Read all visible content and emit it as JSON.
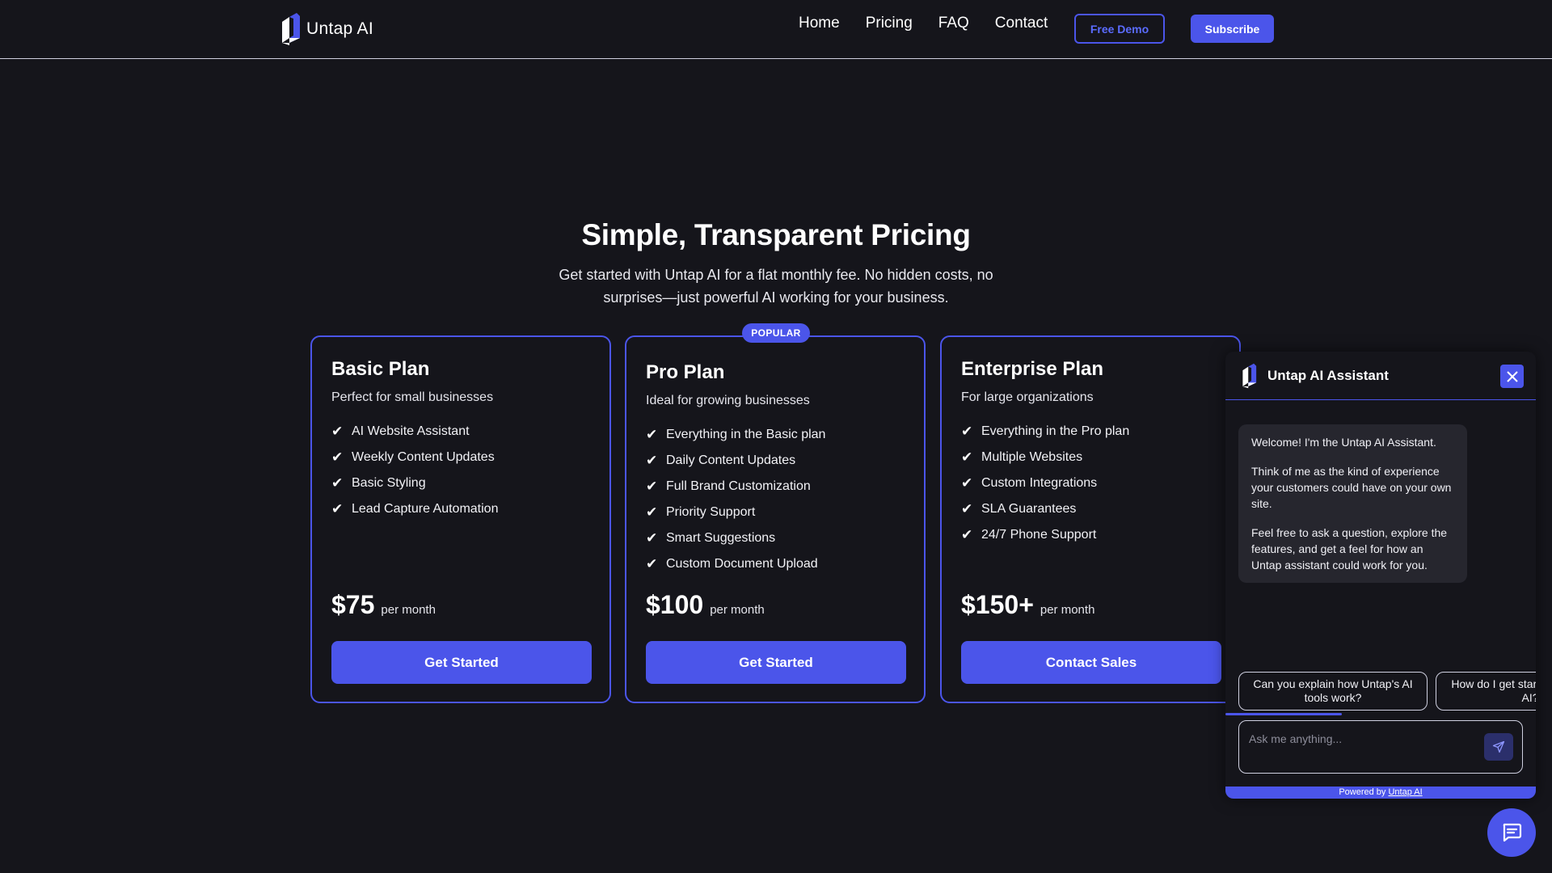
{
  "nav": {
    "brand": "Untap AI",
    "links": [
      "Home",
      "Pricing",
      "FAQ",
      "Contact"
    ],
    "demo_label": "Free Demo",
    "subscribe_label": "Subscribe"
  },
  "hero": {
    "title": "Simple, Transparent Pricing",
    "subtitle": "Get started with Untap AI for a flat monthly fee. No hidden costs, no surprises—just powerful AI working for your business."
  },
  "popular_badge": "POPULAR",
  "plans": [
    {
      "name": "Basic Plan",
      "description": "Perfect for small businesses",
      "features": [
        "AI Website Assistant",
        "Weekly Content Updates",
        "Basic Styling",
        "Lead Capture Automation"
      ],
      "price": "$75",
      "period": "per month",
      "cta": "Get Started"
    },
    {
      "name": "Pro Plan",
      "description": "Ideal for growing businesses",
      "features": [
        "Everything in the Basic plan",
        "Daily Content Updates",
        "Full Brand Customization",
        "Priority Support",
        "Smart Suggestions",
        "Custom Document Upload"
      ],
      "price": "$100",
      "period": "per month",
      "cta": "Get Started"
    },
    {
      "name": "Enterprise Plan",
      "description": "For large organizations",
      "features": [
        "Everything in the Pro plan",
        "Multiple Websites",
        "Custom Integrations",
        "SLA Guarantees",
        "24/7 Phone Support"
      ],
      "price": "$150+",
      "period": "per month",
      "cta": "Contact Sales"
    }
  ],
  "check_glyph": "✔",
  "chat": {
    "title": "Untap AI Assistant",
    "messages": [
      "Welcome! I'm the Untap AI Assistant.",
      "Think of me as the kind of experience your customers could have on your own site.",
      "Feel free to ask a question, explore the features, and get a feel for how an Untap assistant could work for you."
    ],
    "suggestions": [
      "Can you explain how Untap's AI tools work?",
      "How do I get started with Untap AI?"
    ],
    "input_placeholder": "Ask me anything...",
    "footer_prefix": "Powered by ",
    "footer_link": "Untap AI"
  },
  "colors": {
    "background": "#15151b",
    "accent": "#4b55ea",
    "border_light": "#cfd0e0"
  },
  "icons": {
    "brand": "untap-logo-icon",
    "close": "close-icon",
    "send": "send-icon",
    "chat_fab": "chat-bubble-icon"
  }
}
